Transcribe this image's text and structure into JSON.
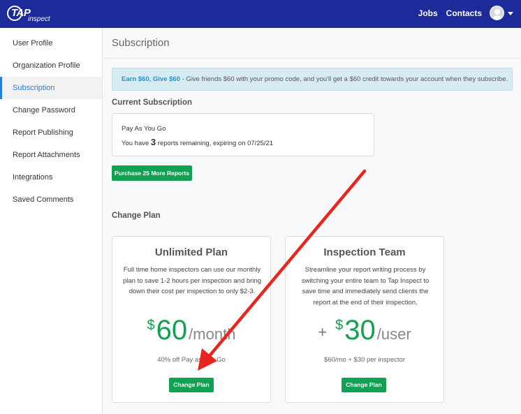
{
  "header": {
    "logo_text": "TAP inspect",
    "nav": [
      "Jobs",
      "Contacts"
    ]
  },
  "sidebar": {
    "items": [
      {
        "label": "User Profile"
      },
      {
        "label": "Organization Profile"
      },
      {
        "label": "Subscription"
      },
      {
        "label": "Change Password"
      },
      {
        "label": "Report Publishing"
      },
      {
        "label": "Report Attachments"
      },
      {
        "label": "Integrations"
      },
      {
        "label": "Saved Comments"
      }
    ],
    "active_index": 2
  },
  "page": {
    "title": "Subscription",
    "promo_highlight": "Earn $60, Give $60",
    "promo_text": " - Give friends $60 with your promo code, and you'll get a $60 credit towards your account when they subscribe.",
    "current_subscription_heading": "Current Subscription",
    "current_plan_name": "Pay As You Go",
    "remaining_prefix": "You have ",
    "remaining_count": "3",
    "remaining_suffix": " reports remaining, expiring on 07/25/21",
    "purchase_button": "Purchase 25 More Reports",
    "change_plan_heading": "Change Plan"
  },
  "plans": [
    {
      "name": "Unlimited Plan",
      "description": "Full time home inspectors can use our monthly plan to save 1-2 hours per inspection and bring down their cost per inspection to only $2-3.",
      "plus": "",
      "currency": "$",
      "amount": "60",
      "period": "/month",
      "subtext": "40% off Pay as You Go",
      "button": "Change Plan"
    },
    {
      "name": "Inspection Team",
      "description": "Streamline your report writing process by switching your entire team to Tap Inspect to save time and immediately send clients the report at the end of their inspection.",
      "plus": "+",
      "currency": "$",
      "amount": "30",
      "period": "/user",
      "subtext": "$60/mo + $30 per inspector",
      "button": "Change Plan"
    }
  ],
  "colors": {
    "topbar": "#1d2a9a",
    "accent_green": "#11a153",
    "active_blue": "#2a7fd8",
    "annotation_red": "#e8261f"
  },
  "icons": {
    "avatar": "user-avatar-icon",
    "menu_caret": "chevron-down-icon"
  }
}
